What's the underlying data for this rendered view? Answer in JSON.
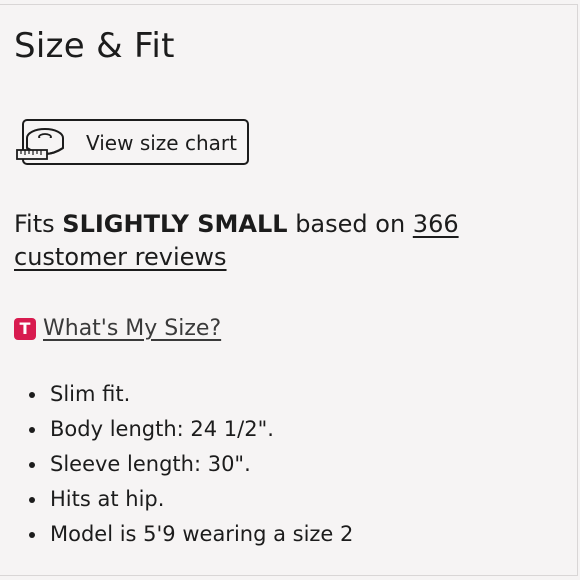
{
  "section": {
    "title": "Size & Fit"
  },
  "size_chart_button": {
    "label": "View size chart",
    "icon": "measuring-tape-icon"
  },
  "fit_summary": {
    "prefix": "Fits ",
    "fit": "SLIGHTLY SMALL",
    "middle": " based on ",
    "reviews_link": "366 customer reviews"
  },
  "whats_my_size": {
    "icon_letter": "T",
    "icon_color": "#d81b4f",
    "label": "What's My Size?"
  },
  "details": [
    "Slim fit.",
    "Body length: 24 1/2\".",
    "Sleeve length: 30\".",
    "Hits at hip.",
    "Model is 5'9 wearing a size 2"
  ]
}
